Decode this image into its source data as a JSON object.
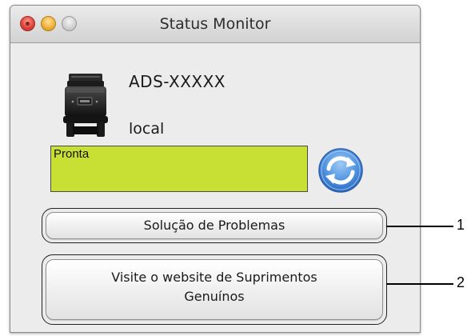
{
  "window": {
    "title": "Status Monitor",
    "controls": [
      "close",
      "minimize",
      "zoom"
    ]
  },
  "device": {
    "model": "ADS-XXXXX",
    "connection": "local",
    "icon": "scanner-icon"
  },
  "status": {
    "text": "Pronta",
    "color": "#c8e034"
  },
  "refresh": {
    "icon": "refresh-icon"
  },
  "buttons": {
    "troubleshoot": "Solução de Problemas",
    "supplies_line1": "Visite o website de Suprimentos",
    "supplies_line2": "Genuínos"
  },
  "callouts": [
    "1",
    "2"
  ]
}
